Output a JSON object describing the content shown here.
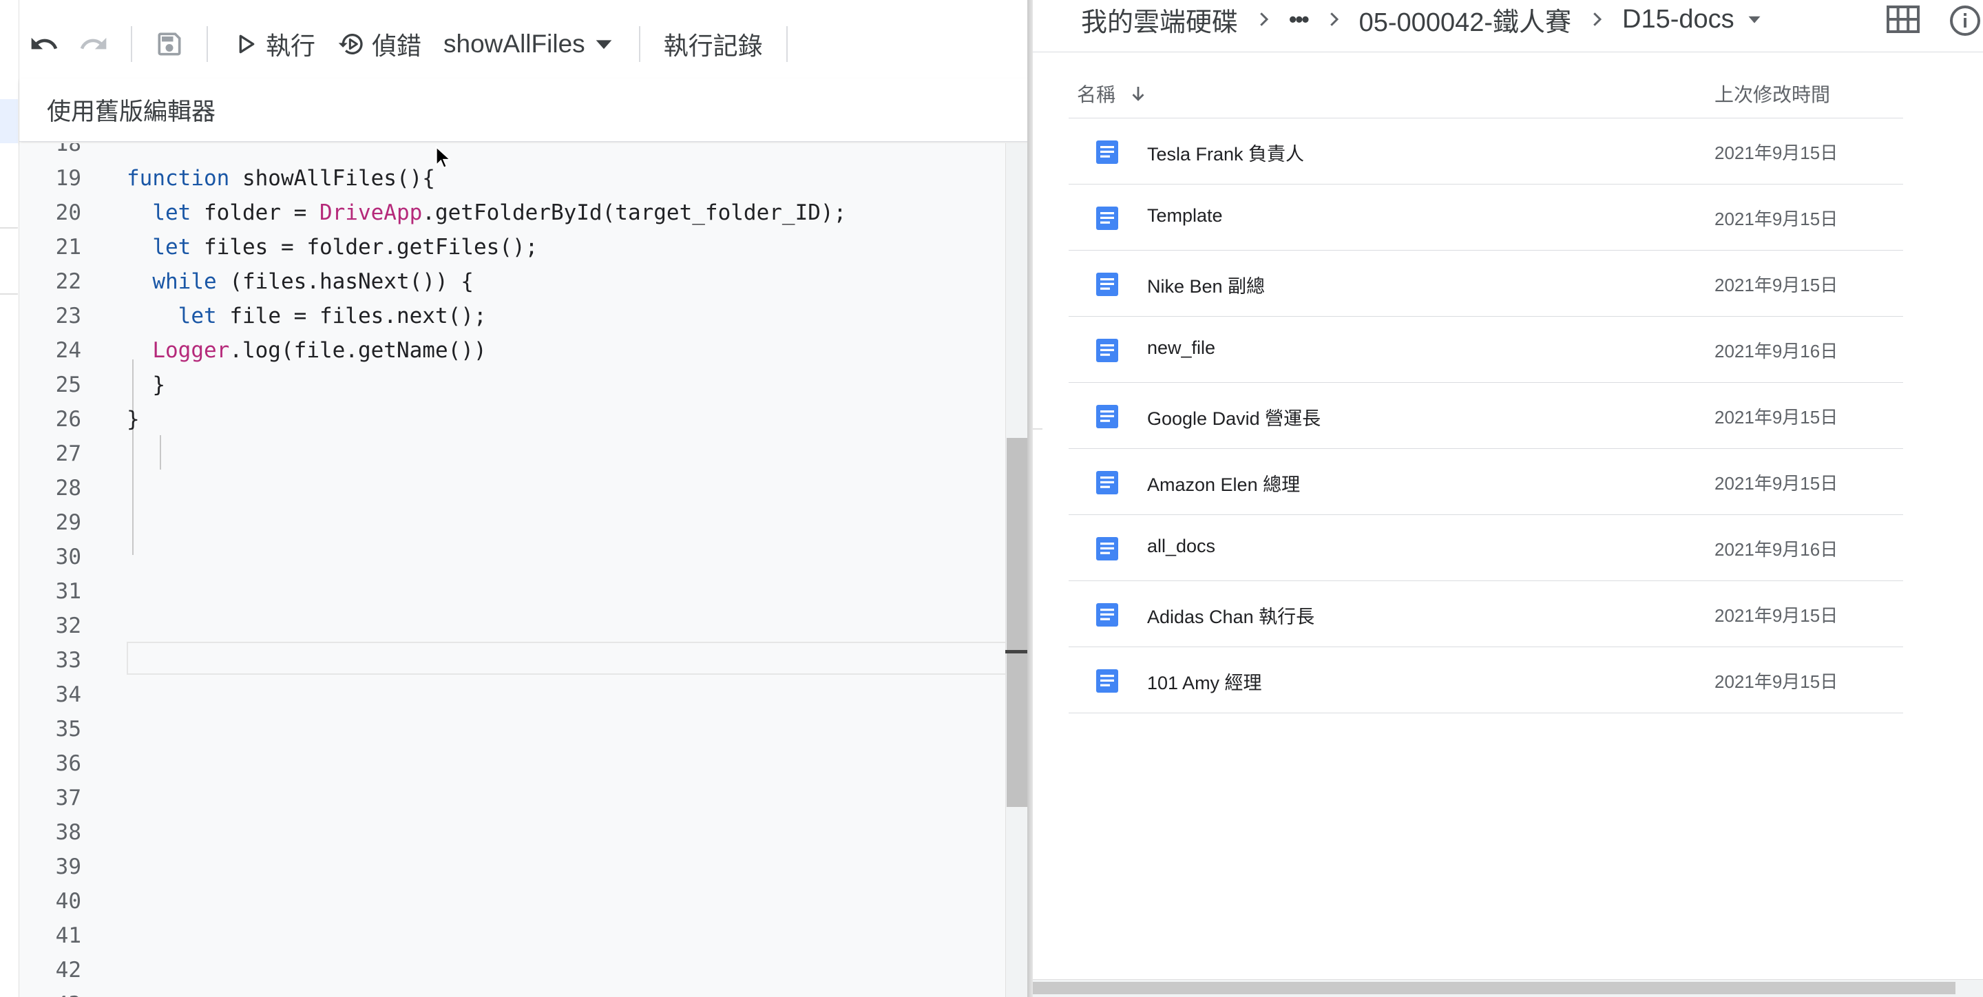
{
  "editor": {
    "toolbar": {
      "run_label": "執行",
      "debug_label": "偵錯",
      "function_name": "showAllFiles",
      "exec_log_label": "執行記錄"
    },
    "legacy_editor_label": "使用舊版編輯器",
    "code_lines": [
      {
        "num": "18",
        "code": ""
      },
      {
        "num": "19",
        "code": "function showAllFiles(){"
      },
      {
        "num": "20",
        "code": "  let folder = DriveApp.getFolderById(target_folder_ID);"
      },
      {
        "num": "21",
        "code": "  let files = folder.getFiles();"
      },
      {
        "num": "22",
        "code": "  while (files.hasNext()) {"
      },
      {
        "num": "23",
        "code": "    let file = files.next();"
      },
      {
        "num": "24",
        "code": "  Logger.log(file.getName())"
      },
      {
        "num": "25",
        "code": "  }"
      },
      {
        "num": "26",
        "code": "}"
      },
      {
        "num": "27",
        "code": ""
      },
      {
        "num": "28",
        "code": ""
      },
      {
        "num": "29",
        "code": ""
      },
      {
        "num": "30",
        "code": ""
      },
      {
        "num": "31",
        "code": ""
      },
      {
        "num": "32",
        "code": ""
      },
      {
        "num": "33",
        "code": ""
      },
      {
        "num": "34",
        "code": ""
      },
      {
        "num": "35",
        "code": ""
      },
      {
        "num": "36",
        "code": ""
      },
      {
        "num": "37",
        "code": ""
      },
      {
        "num": "38",
        "code": ""
      },
      {
        "num": "39",
        "code": ""
      },
      {
        "num": "40",
        "code": ""
      },
      {
        "num": "41",
        "code": ""
      },
      {
        "num": "42",
        "code": ""
      },
      {
        "num": "43",
        "code": ""
      }
    ],
    "syntax_colors": {
      "keyword": "#1a57a6",
      "class": "#b5297a",
      "text": "#202124"
    }
  },
  "drive": {
    "breadcrumb": {
      "root": "我的雲端硬碟",
      "ellipsis": "•••",
      "folder": "05-000042-鐵人賽",
      "current": "D15-docs"
    },
    "columns": {
      "name": "名稱",
      "modified": "上次修改時間"
    },
    "files": [
      {
        "name": "Tesla Frank 負責人",
        "modified": "2021年9月15日"
      },
      {
        "name": "Template",
        "modified": "2021年9月15日"
      },
      {
        "name": "Nike Ben 副總",
        "modified": "2021年9月15日"
      },
      {
        "name": "new_file",
        "modified": "2021年9月16日"
      },
      {
        "name": "Google David 營運長",
        "modified": "2021年9月15日"
      },
      {
        "name": "Amazon Elen 總理",
        "modified": "2021年9月15日"
      },
      {
        "name": "all_docs",
        "modified": "2021年9月16日"
      },
      {
        "name": "Adidas Chan 執行長",
        "modified": "2021年9月15日"
      },
      {
        "name": "101 Amy 經理",
        "modified": "2021年9月15日"
      }
    ],
    "doc_icon_color": "#4285f4",
    "icons": {
      "sort": "arrow-down-icon",
      "grid": "grid-view-icon",
      "info": "info-icon"
    }
  }
}
